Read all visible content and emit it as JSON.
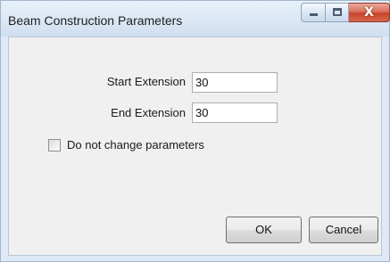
{
  "window": {
    "title": "Beam Construction Parameters",
    "controls": {
      "minimize_icon": "minimize-icon",
      "maximize_icon": "maximize-icon",
      "close_icon": "close-icon",
      "close_glyph": "X"
    }
  },
  "form": {
    "start_extension": {
      "label": "Start Extension",
      "value": "30"
    },
    "end_extension": {
      "label": "End Extension",
      "value": "30"
    },
    "no_change": {
      "label": "Do not change parameters",
      "checked": false
    }
  },
  "buttons": {
    "ok_label": "OK",
    "cancel_label": "Cancel"
  },
  "colors": {
    "titlebar": "#dbe7f4",
    "client": "#f0f0f0",
    "close_button": "#c7452b"
  }
}
